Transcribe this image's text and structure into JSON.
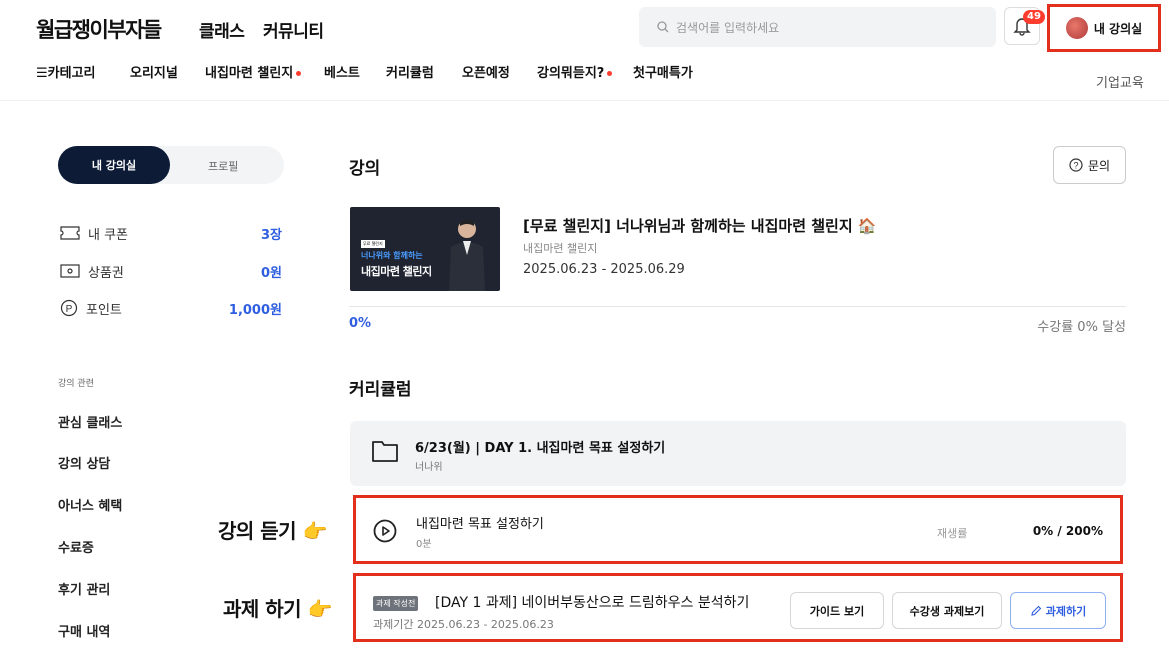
{
  "header": {
    "logo": "월급쟁이부자들",
    "nav": [
      "클래스",
      "커뮤니티"
    ],
    "search_placeholder": "검색어를 입력하세요",
    "notif_count": "49",
    "my_room": "내 강의실"
  },
  "categories": [
    {
      "label": "☰카테고리",
      "dot": false
    },
    {
      "label": "오리지널",
      "dot": false
    },
    {
      "label": "내집마련 챌린지",
      "dot": true
    },
    {
      "label": "베스트",
      "dot": false
    },
    {
      "label": "커리큘럼",
      "dot": false
    },
    {
      "label": "오픈예정",
      "dot": false
    },
    {
      "label": "강의뭐듣지?",
      "dot": true
    },
    {
      "label": "첫구매특가",
      "dot": false
    }
  ],
  "corp_edu": "기업교육",
  "sidebar": {
    "tabs": {
      "active": "내 강의실",
      "other": "프로필"
    },
    "stats": [
      {
        "icon": "coupon-icon",
        "label": "내 쿠폰",
        "value": "3장"
      },
      {
        "icon": "gift-card-icon",
        "label": "상품권",
        "value": "0원"
      },
      {
        "icon": "point-icon",
        "label": "포인트",
        "value": "1,000원"
      }
    ],
    "section_label": "강의 관련",
    "links": [
      "관심 클래스",
      "강의 상담",
      "아너스 혜택",
      "수료증",
      "후기 관리",
      "구매 내역"
    ]
  },
  "annotations": {
    "listen": "강의 듣기 👉",
    "task": "과제 하기 👉"
  },
  "main": {
    "lecture_heading": "강의",
    "inquiry": "문의",
    "course": {
      "thumb_tag": "무료 챌린지",
      "thumb_line1": "너나위와 함께하는",
      "thumb_line2": "내집마련 챌린지",
      "title": "[무료 챌린지] 너나위님과 함께하는 내집마련 챌린지 🏠",
      "subtitle": "내집마련 챌린지",
      "dates": "2025.06.23 - 2025.06.29",
      "progress_pct": "0%",
      "progress_text": "수강률 0% 달성"
    },
    "curriculum_heading": "커리큘럼",
    "chapter": {
      "title": "6/23(월) | DAY 1. 내집마련 목표 설정하기",
      "author": "너나위"
    },
    "lesson": {
      "title": "내집마련 목표 설정하기",
      "duration": "0분",
      "rate_label": "재생률",
      "rate_value": "0% / 200%"
    },
    "task": {
      "status": "과제 작성전",
      "title": "[DAY 1 과제] 네이버부동산으로 드림하우스 분석하기",
      "period": "과제기간 2025.06.23 - 2025.06.23",
      "btn_guide": "가이드 보기",
      "btn_peers": "수강생 과제보기",
      "btn_do": "과제하기"
    }
  },
  "colors": {
    "accent": "#2f5fe0",
    "highlight": "#e2301c",
    "navy": "#0d1b36"
  }
}
